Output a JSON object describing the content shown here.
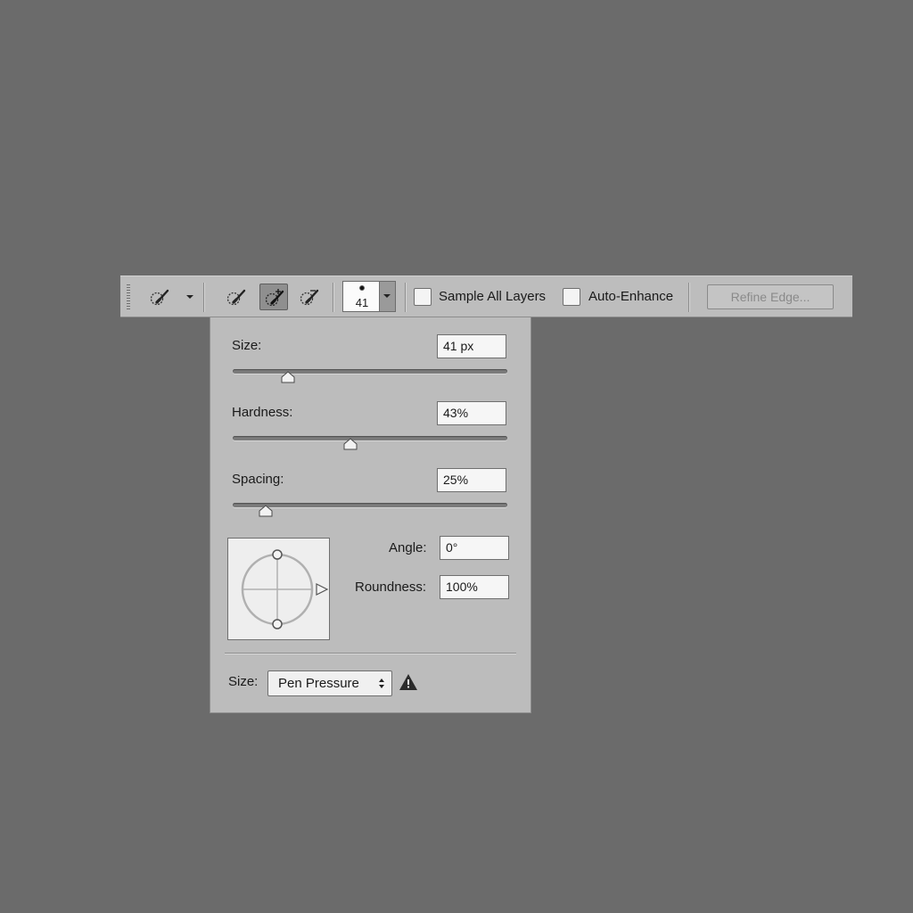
{
  "options_bar": {
    "tool_preset_icon": "quick-selection-brush-icon",
    "selection_modes": [
      {
        "name": "new-selection",
        "icon": "quick-selection-brush-icon",
        "active": false
      },
      {
        "name": "add-to-selection",
        "icon": "quick-selection-add-icon",
        "active": true
      },
      {
        "name": "subtract-from-selection",
        "icon": "quick-selection-subtract-icon",
        "active": false
      }
    ],
    "brush_size": "41",
    "sample_all_layers": {
      "label": "Sample All Layers",
      "checked": false
    },
    "auto_enhance": {
      "label": "Auto-Enhance",
      "checked": false
    },
    "refine_edge": {
      "label": "Refine Edge...",
      "enabled": false
    }
  },
  "brush_panel": {
    "size": {
      "label": "Size:",
      "value": "41 px",
      "slider_fraction": 0.2
    },
    "hardness": {
      "label": "Hardness:",
      "value": "43%",
      "slider_fraction": 0.43
    },
    "spacing": {
      "label": "Spacing:",
      "value": "25%",
      "slider_fraction": 0.12
    },
    "angle": {
      "label": "Angle:",
      "value": "0°"
    },
    "roundness": {
      "label": "Roundness:",
      "value": "100%"
    },
    "pressure": {
      "label": "Size:",
      "selected": "Pen Pressure",
      "warning_icon": "warning-icon"
    }
  },
  "colors": {
    "background": "#6b6b6b",
    "panel": "#bcbcbc",
    "field": "#f6f6f6"
  }
}
